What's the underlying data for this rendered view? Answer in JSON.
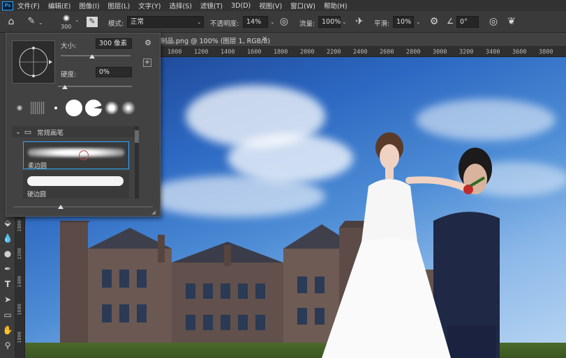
{
  "app": {
    "logo": "Ps"
  },
  "menu": [
    "文件(F)",
    "编辑(E)",
    "图像(I)",
    "图层(L)",
    "文字(Y)",
    "选择(S)",
    "滤镜(T)",
    "3D(D)",
    "视图(V)",
    "窗口(W)",
    "帮助(H)"
  ],
  "options": {
    "brush_size": "300",
    "mode_label": "模式:",
    "mode_value": "正常",
    "opacity_label": "不透明度:",
    "opacity_value": "14%",
    "flow_label": "流量:",
    "flow_value": "100%",
    "smoothing_label": "平滑:",
    "smoothing_value": "10%",
    "angle_value": "0°"
  },
  "document": {
    "tab_label": "制品.png @ 100% (图层 1, RGB/8)",
    "close_glyph": "×",
    "ruler_ticks": [
      "1000",
      "1200",
      "1400",
      "1600",
      "1800",
      "2000",
      "2200",
      "2400",
      "2600",
      "2800",
      "3000",
      "3200",
      "3400",
      "3600",
      "3800"
    ],
    "left_ruler_ticks": [
      "1000",
      "1200",
      "1400",
      "1600",
      "1800"
    ]
  },
  "brush_panel": {
    "size_label": "大小:",
    "size_value": "300 像素",
    "hardness_label": "硬度:",
    "hardness_value": "0%",
    "size_fraction": 0.45,
    "hardness_fraction": 0.0,
    "folder_name": "常规画笔",
    "brushes": [
      {
        "name": "柔边圆",
        "selected": true
      },
      {
        "name": "硬边圆",
        "selected": false
      }
    ]
  },
  "colors": {
    "accent": "#31a8ff",
    "panel_bg": "#424242",
    "menubar_bg": "#323232"
  }
}
